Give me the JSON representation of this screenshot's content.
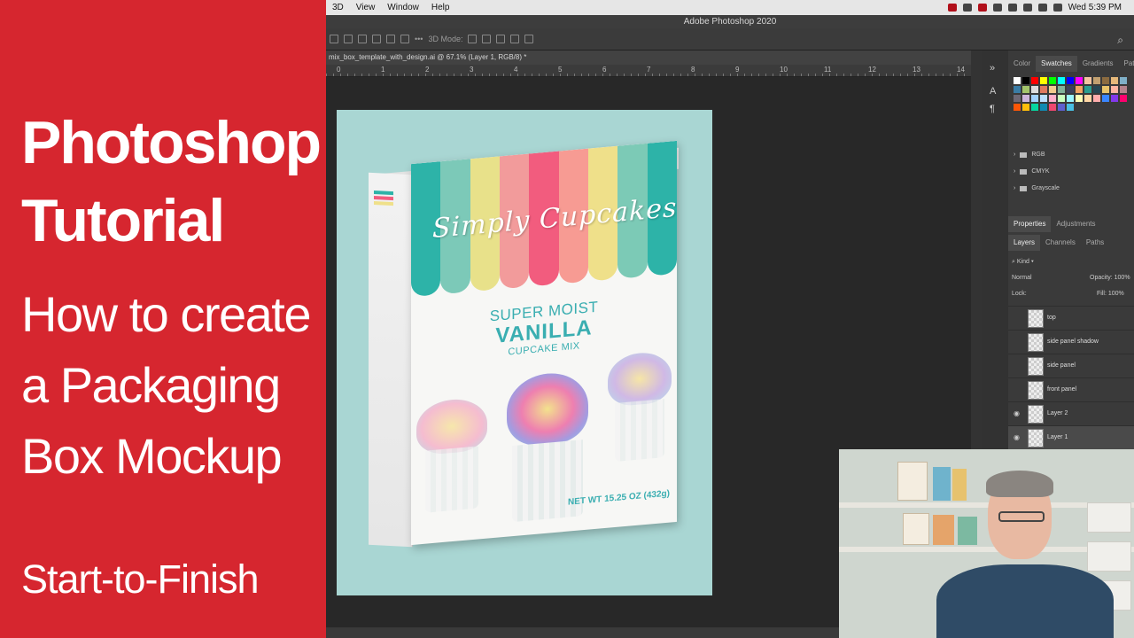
{
  "tutorial": {
    "title_line1": "Photoshop",
    "title_line2": "Tutorial",
    "subtitle_line1": "How to create",
    "subtitle_line2": "a Packaging",
    "subtitle_line3": "Box Mockup",
    "footer": "Start-to-Finish"
  },
  "menubar": {
    "items": [
      "3D",
      "View",
      "Window",
      "Help"
    ],
    "clock": "Wed 5:39 PM"
  },
  "window": {
    "title": "Adobe Photoshop 2020"
  },
  "options_bar": {
    "mode_label": "3D Mode:"
  },
  "document": {
    "tab_label": "mix_box_template_with_design.ai @ 67.1% (Layer 1, RGB/8) *",
    "ruler_labels": [
      "0",
      "1",
      "2",
      "3",
      "4",
      "5",
      "6",
      "7",
      "8",
      "9",
      "10",
      "11",
      "12",
      "13",
      "14"
    ]
  },
  "box_design": {
    "brand": "Simply Cupcakes",
    "line1": "SUPER MOIST",
    "line2": "VANILLA",
    "line3": "CUPCAKE MIX",
    "net_weight": "NET WT 15.25 OZ (432g)",
    "stripe_colors": [
      "#2db3a8",
      "#7cc9b8",
      "#e8e18a",
      "#f29b9b",
      "#f25c7e",
      "#f79b93",
      "#efe08a",
      "#7ccab6",
      "#2db3a8"
    ]
  },
  "panels": {
    "color_tabs": [
      "Color",
      "Swatches",
      "Gradients",
      "Patte"
    ],
    "swatch_colors": [
      "#ffffff",
      "#000000",
      "#ff0000",
      "#ffff00",
      "#00ff00",
      "#00ffff",
      "#0000ff",
      "#ff00ff",
      "#f4c4a0",
      "#c2a070",
      "#8b6b40",
      "#e6b87a",
      "#7fb0c8",
      "#3a7ca5",
      "#a3c46b",
      "#ddd",
      "#e07a5f",
      "#f2cc8f",
      "#81b29a",
      "#3d405b",
      "#f4a261",
      "#2a9d8f",
      "#264653",
      "#e9c46a",
      "#ffb4a2",
      "#b5838d",
      "#6d6875",
      "#cdb4db",
      "#a2d2ff",
      "#bde0fe",
      "#ffafcc",
      "#caffbf",
      "#9bf6ff",
      "#fdffb6",
      "#ffd6a5",
      "#ffadad",
      "#3a86ff",
      "#8338ec",
      "#ff006e",
      "#fb5607",
      "#ffbe0b",
      "#06d6a0",
      "#118ab2",
      "#ef476f",
      "#5e60ce",
      "#48bfe3"
    ],
    "swatch_folders": [
      "RGB",
      "CMYK",
      "Grayscale"
    ],
    "props_tabs": [
      "Properties",
      "Adjustments"
    ],
    "layer_tabs": [
      "Layers",
      "Channels",
      "Paths"
    ],
    "kind_label": "Kind",
    "blend_mode": "Normal",
    "opacity_label": "Opacity:",
    "opacity_value": "100%",
    "lock_label": "Lock:",
    "fill_label": "Fill:",
    "fill_value": "100%",
    "layers": [
      {
        "name": "top",
        "visible": false
      },
      {
        "name": "side panel shadow",
        "visible": false
      },
      {
        "name": "side panel",
        "visible": false
      },
      {
        "name": "front panel",
        "visible": false
      },
      {
        "name": "Layer 2",
        "visible": true
      },
      {
        "name": "Layer 1",
        "visible": true
      }
    ]
  }
}
